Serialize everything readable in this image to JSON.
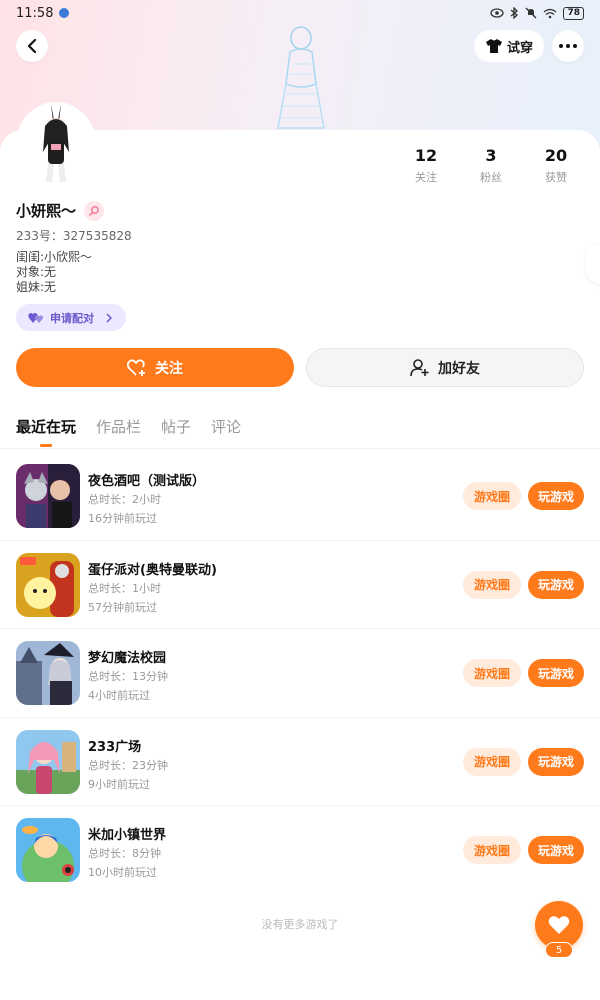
{
  "status_bar": {
    "time": "11:58",
    "battery": "78"
  },
  "header": {
    "try_on_label": "试穿"
  },
  "profile": {
    "name": "小妍熙～",
    "uid": "233号：327535828",
    "bio": [
      "闺闺:小欣熙～",
      "对象:无",
      "姐妹:无"
    ],
    "pair_label": "申请配对",
    "stats": [
      {
        "value": "12",
        "label": "关注"
      },
      {
        "value": "3",
        "label": "粉丝"
      },
      {
        "value": "20",
        "label": "获赞"
      }
    ]
  },
  "actions": {
    "follow_label": "关注",
    "add_friend_label": "加好友"
  },
  "tabs": [
    "最近在玩",
    "作品栏",
    "帖子",
    "评论"
  ],
  "games": [
    {
      "name": "夜色酒吧（测试版）",
      "duration": "总时长：2小时",
      "last_played": "16分钟前玩过",
      "icon": "night-bar-game-icon"
    },
    {
      "name": "蛋仔派对(奥特曼联动)",
      "duration": "总时长：1小时",
      "last_played": "57分钟前玩过",
      "icon": "egg-party-game-icon"
    },
    {
      "name": "梦幻魔法校园",
      "duration": "总时长：13分钟",
      "last_played": "4小时前玩过",
      "icon": "magic-school-game-icon"
    },
    {
      "name": "233广场",
      "duration": "总时长：23分钟",
      "last_played": "9小时前玩过",
      "icon": "plaza-233-game-icon"
    },
    {
      "name": "米加小镇世界",
      "duration": "总时长：8分钟",
      "last_played": "10小时前玩过",
      "icon": "miga-town-game-icon"
    }
  ],
  "game_buttons": {
    "circle_label": "游戏圈",
    "play_label": "玩游戏"
  },
  "footer": {
    "no_more": "没有更多游戏了",
    "like_count": "5"
  },
  "colors": {
    "accent": "#ff7a1a",
    "accent_light": "#ffeadb",
    "pair_bg": "#ece8ff",
    "pair_text": "#6a5acd"
  }
}
